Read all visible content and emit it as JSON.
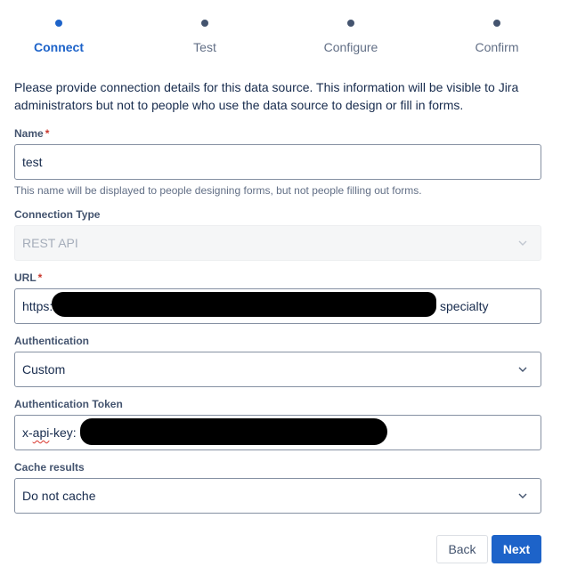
{
  "stepper": {
    "steps": [
      {
        "label": "Connect",
        "active": true
      },
      {
        "label": "Test",
        "active": false
      },
      {
        "label": "Configure",
        "active": false
      },
      {
        "label": "Confirm",
        "active": false
      }
    ]
  },
  "intro_text": "Please provide connection details for this data source. This information will be visible to Jira administrators but not to people who use the data source to design or fill in forms.",
  "fields": {
    "name": {
      "label": "Name",
      "required_marker": "*",
      "value": "test",
      "helper": "This name will be displayed to people designing forms, but not people filling out forms."
    },
    "connection_type": {
      "label": "Connection Type",
      "value": "REST API",
      "disabled": true
    },
    "url": {
      "label": "URL",
      "required_marker": "*",
      "value_prefix": "https:",
      "value_suffix": "specialty"
    },
    "authentication": {
      "label": "Authentication",
      "value": "Custom"
    },
    "auth_token": {
      "label": "Authentication Token",
      "value_prefix": "x-",
      "value_misspelled": "api",
      "value_rest": "-key:"
    },
    "cache": {
      "label": "Cache results",
      "value": "Do not cache"
    }
  },
  "buttons": {
    "back": "Back",
    "next": "Next"
  },
  "colors": {
    "accent": "#1d63c9",
    "required": "#c9372c",
    "redaction": "#000000"
  },
  "icons": {
    "select_chevron": "chevron-down-icon"
  }
}
